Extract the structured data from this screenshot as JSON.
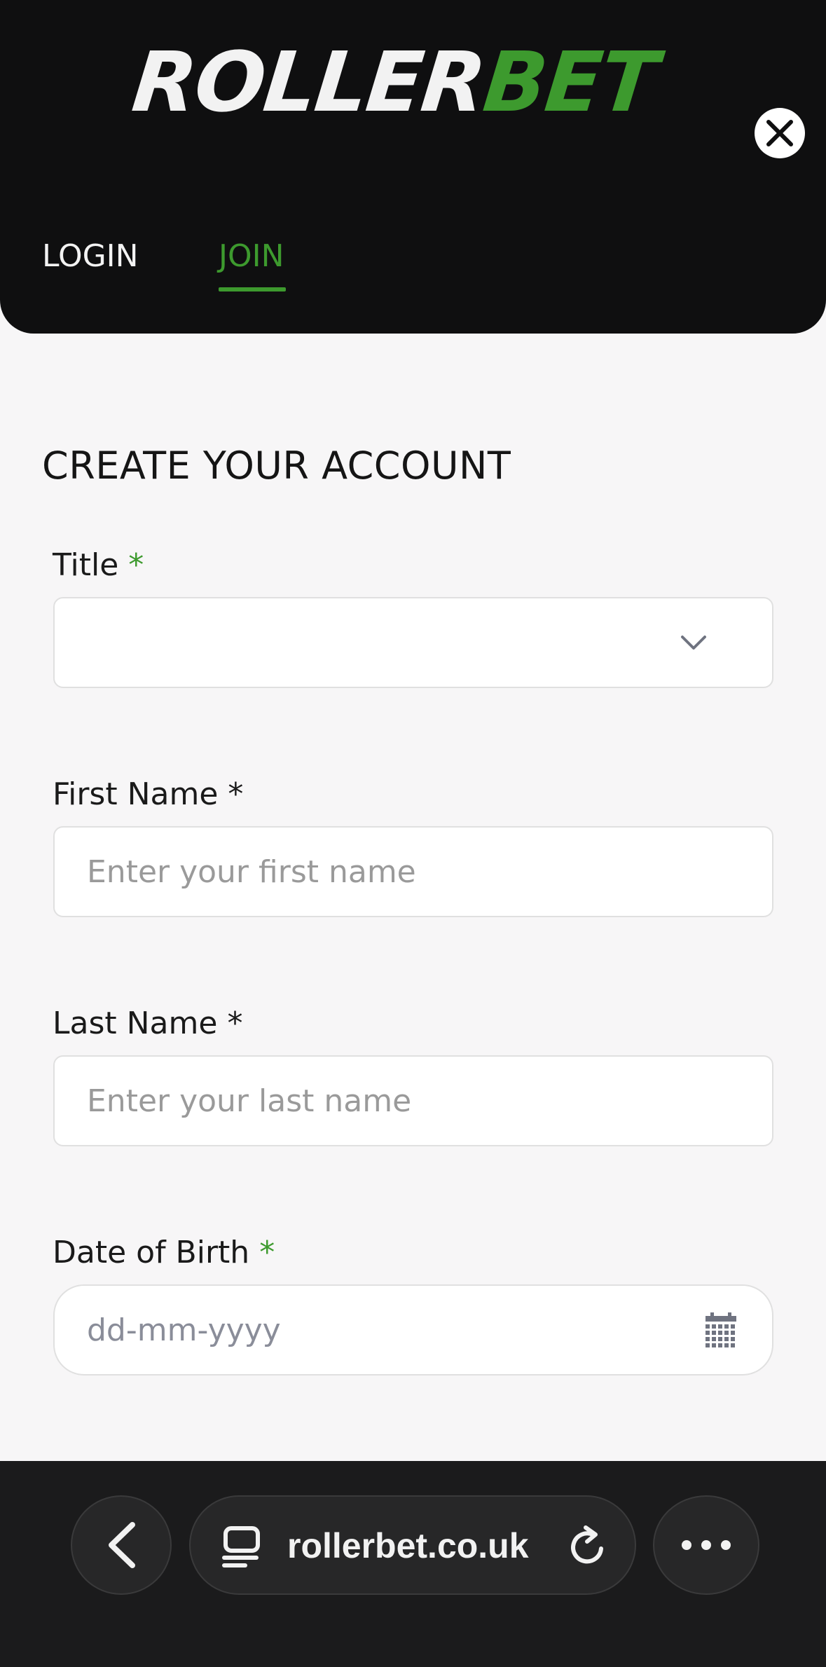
{
  "header": {
    "logo_white": "ROLLER",
    "logo_green": "BET",
    "close_icon": "close-icon",
    "tabs": [
      {
        "label": "LOGIN",
        "active": false
      },
      {
        "label": "JOIN",
        "active": true
      }
    ]
  },
  "form": {
    "title": "CREATE YOUR ACCOUNT",
    "fields": {
      "title": {
        "label": "Title",
        "required_mark": "*",
        "value": ""
      },
      "first_name": {
        "label": "First Name",
        "required_mark": "*",
        "placeholder": "Enter your first name"
      },
      "last_name": {
        "label": "Last Name",
        "required_mark": "*",
        "placeholder": "Enter your last name"
      },
      "dob": {
        "label": "Date of Birth",
        "required_mark": "*",
        "placeholder": "dd-mm-yyyy"
      }
    }
  },
  "browser": {
    "url": "rollerbet.co.uk",
    "icons": [
      "back-icon",
      "tabs-icon",
      "reload-icon",
      "more-icon"
    ]
  },
  "colors": {
    "accent_green": "#3d9a2e",
    "header_bg": "#0f0f10",
    "page_bg": "#f7f6f7",
    "bottom_bar_bg": "#1b1b1c"
  }
}
